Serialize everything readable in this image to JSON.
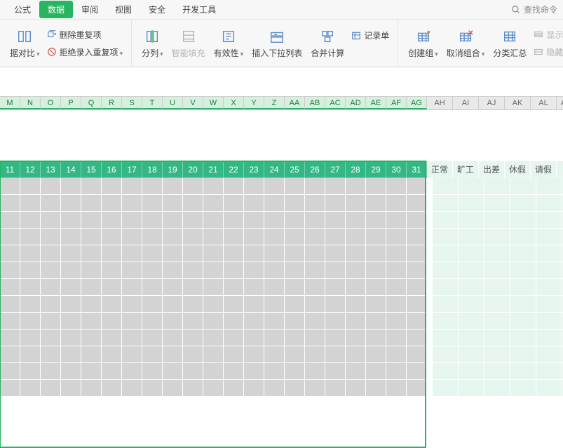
{
  "menubar": {
    "items": [
      "公式",
      "数据",
      "审阅",
      "视图",
      "安全",
      "开发工具"
    ],
    "active_index": 1,
    "search_label": "查找命令"
  },
  "toolbar": {
    "g1": {
      "compare": "据对比",
      "remove_dup": "删除重复项",
      "reject_dup": "拒绝录入重复项"
    },
    "g2": {
      "split_cols": "分列",
      "smart_fill": "智能填充",
      "validity": "有效性",
      "insert_dropdown": "插入下拉列表",
      "consolidate": "合并计算",
      "record_form": "记录单"
    },
    "g3": {
      "group": "创建组",
      "ungroup": "取消组合",
      "subtotal": "分类汇总",
      "show_detail": "显示明细",
      "hide_detail": "隐藏明细"
    }
  },
  "columns": {
    "sel": [
      "M",
      "N",
      "O",
      "P",
      "Q",
      "R",
      "S",
      "T",
      "U",
      "V",
      "W",
      "X",
      "Y",
      "Z",
      "AA",
      "AB",
      "AC",
      "AD",
      "AE",
      "AF",
      "AG"
    ],
    "unsel": [
      "AH",
      "AI",
      "AJ",
      "AK",
      "AL"
    ]
  },
  "headers": {
    "days": [
      "11",
      "12",
      "13",
      "14",
      "15",
      "16",
      "17",
      "18",
      "19",
      "20",
      "21",
      "22",
      "23",
      "24",
      "25",
      "26",
      "27",
      "28",
      "29",
      "30",
      "31"
    ],
    "cats": [
      "正常",
      "旷工",
      "出差",
      "休假",
      "请假"
    ]
  },
  "grid": {
    "rows": 13
  }
}
